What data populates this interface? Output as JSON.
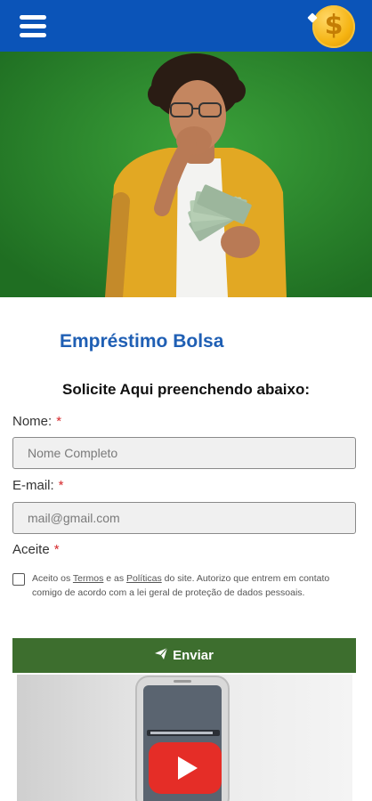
{
  "header": {
    "menu_icon": "hamburger-menu-icon",
    "logo_icon": "gold-dollar-coin-icon",
    "logo_symbol": "$"
  },
  "hero": {
    "image": "man-surprised-holding-cash-on-green-background",
    "background_color": "#2d8a2d"
  },
  "brand": {
    "title": "Empréstimo Bolsa"
  },
  "form": {
    "subtitle": "Solicite Aqui preenchendo abaixo:",
    "name_label": "Nome:",
    "name_placeholder": "Nome Completo",
    "email_label": "E-mail:",
    "email_placeholder": "mail@gmail.com",
    "accept_label": "Aceite",
    "required_mark": "*",
    "consent": {
      "prefix": "Aceito os ",
      "terms_link": "Termos",
      "middle": " e as ",
      "policies_link": "Políticas",
      "suffix": " do site. Autorizo que entrem em contato comigo de acordo com a lei geral de proteção de dados pessoais."
    },
    "submit_label": "Enviar",
    "submit_icon": "paper-plane-icon"
  },
  "promo": {
    "image": "phone-with-video-play-button",
    "play_icon": "youtube-play-icon"
  },
  "colors": {
    "header_bg": "#0b54b8",
    "brand_text": "#1f5fb4",
    "submit_bg": "#3d6e2e",
    "required": "#d6282b"
  }
}
